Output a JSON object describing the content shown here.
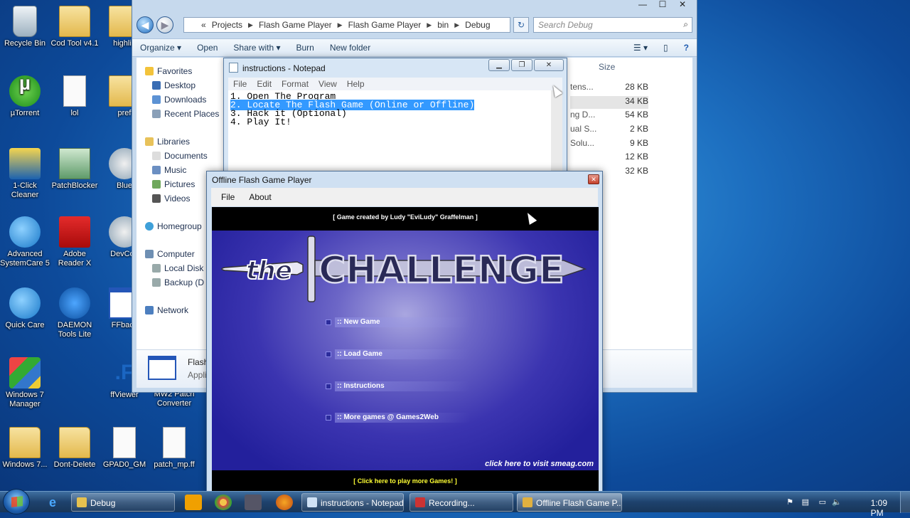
{
  "desktop": {
    "icons": [
      {
        "label": "Recycle Bin"
      },
      {
        "label": "Cod Tool v4.1"
      },
      {
        "label": "highlig"
      },
      {
        "label": "µTorrent"
      },
      {
        "label": "lol"
      },
      {
        "label": "pref"
      },
      {
        "label": "1-Click Cleaner"
      },
      {
        "label": "PatchBlocker"
      },
      {
        "label": "Blue"
      },
      {
        "label": "Advanced SystemCare 5"
      },
      {
        "label": "Adobe Reader X"
      },
      {
        "label": "DevCon"
      },
      {
        "label": "Quick Care"
      },
      {
        "label": "DAEMON Tools Lite"
      },
      {
        "label": "FFback"
      },
      {
        "label": "Windows 7 Manager"
      },
      {
        "label": "ffViewer"
      },
      {
        "label": "MW2 Patch Converter"
      },
      {
        "label": "Windows 7..."
      },
      {
        "label": "Dont-Delete"
      },
      {
        "label": "GPAD0_GM"
      },
      {
        "label": "patch_mp.ff"
      }
    ]
  },
  "explorer": {
    "breadcrumb": [
      "«",
      "Projects",
      "Flash Game Player",
      "Flash Game Player",
      "bin",
      "Debug"
    ],
    "search_placeholder": "Search Debug",
    "toolbar": {
      "organize": "Organize ▾",
      "open": "Open",
      "share": "Share with ▾",
      "burn": "Burn",
      "new_folder": "New folder"
    },
    "nav": {
      "favorites": "Favorites",
      "desktop": "Desktop",
      "downloads": "Downloads",
      "recent": "Recent Places",
      "libraries": "Libraries",
      "documents": "Documents",
      "music": "Music",
      "pictures": "Pictures",
      "videos": "Videos",
      "homegroup": "Homegroup",
      "computer": "Computer",
      "local_disk": "Local Disk",
      "backup": "Backup (D",
      "network": "Network"
    },
    "size_header": "Size",
    "files": [
      {
        "name": "tens...",
        "size": "28 KB"
      },
      {
        "name": "",
        "size": "34 KB"
      },
      {
        "name": "ng D...",
        "size": "54 KB"
      },
      {
        "name": "ual S...",
        "size": "2 KB"
      },
      {
        "name": "Solu...",
        "size": "9 KB"
      },
      {
        "name": "",
        "size": "12 KB"
      },
      {
        "name": "",
        "size": "32 KB"
      }
    ],
    "details": {
      "name": "Flash",
      "type": "Appli"
    }
  },
  "notepad": {
    "title": "instructions - Notepad",
    "menu": [
      "File",
      "Edit",
      "Format",
      "View",
      "Help"
    ],
    "lines": [
      "1. Open The Program",
      "2. Locate The Flash Game (Online or Offline)",
      "3. Hack it (Optional)",
      "4. Play It!"
    ]
  },
  "flash_player": {
    "title": "Offline Flash Game Player",
    "menu": [
      "File",
      "About"
    ],
    "game": {
      "credit": "[ Game created by Ludy \"EviLudy\" Graffelman ]",
      "logo_the": "the",
      "logo_challenge": "CHALLENGE",
      "options": [
        ":: New Game",
        ":: Load Game",
        ":: Instructions",
        ":: More games @ Games2Web"
      ],
      "visit": "click here to visit smeag.com",
      "bottom": "[ Click here to play more Games! ]"
    }
  },
  "taskbar": {
    "tasks": [
      "Debug",
      "instructions - Notepad",
      "Recording...",
      "Offline Flash Game P..."
    ],
    "clock": "1:09 PM"
  }
}
